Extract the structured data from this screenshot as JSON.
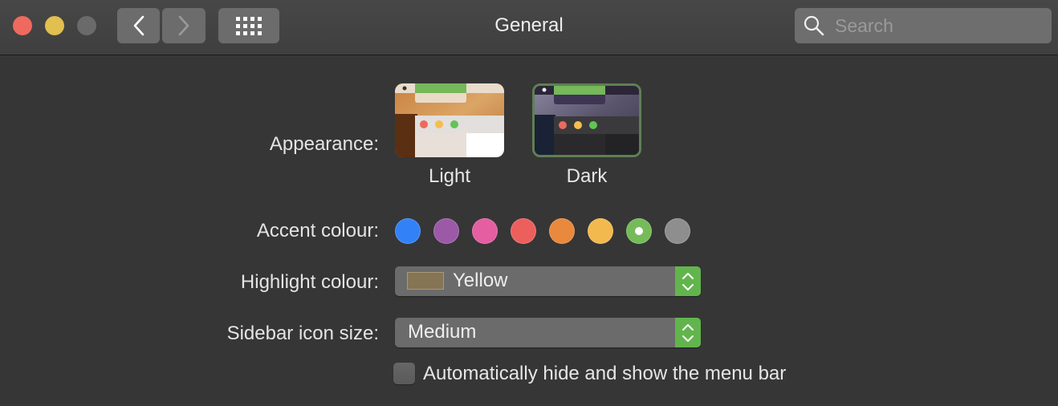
{
  "window": {
    "title": "General",
    "search_placeholder": "Search",
    "icons": {
      "back": "chevron-left-icon",
      "forward": "chevron-right-icon",
      "show_all": "grid-icon",
      "search": "magnifier-icon"
    }
  },
  "appearance": {
    "label": "Appearance:",
    "options": [
      {
        "name": "Light",
        "selected": false
      },
      {
        "name": "Dark",
        "selected": true
      }
    ]
  },
  "accent": {
    "label": "Accent colour:",
    "colors": [
      {
        "name": "Blue",
        "hex": "#3381f7",
        "selected": false
      },
      {
        "name": "Purple",
        "hex": "#9b59a8",
        "selected": false
      },
      {
        "name": "Pink",
        "hex": "#e45ea1",
        "selected": false
      },
      {
        "name": "Red",
        "hex": "#ec5f5d",
        "selected": false
      },
      {
        "name": "Orange",
        "hex": "#e8893d",
        "selected": false
      },
      {
        "name": "Yellow",
        "hex": "#f2b94f",
        "selected": false
      },
      {
        "name": "Green",
        "hex": "#76bb5a",
        "selected": true
      },
      {
        "name": "Graphite",
        "hex": "#8e8e8e",
        "selected": false
      }
    ]
  },
  "highlight": {
    "label": "Highlight colour:",
    "value": "Yellow",
    "swatch_hex": "#857554"
  },
  "sidebar_icon_size": {
    "label": "Sidebar icon size:",
    "value": "Medium"
  },
  "menubar": {
    "label": "Automatically hide and show the menu bar",
    "checked": false
  }
}
